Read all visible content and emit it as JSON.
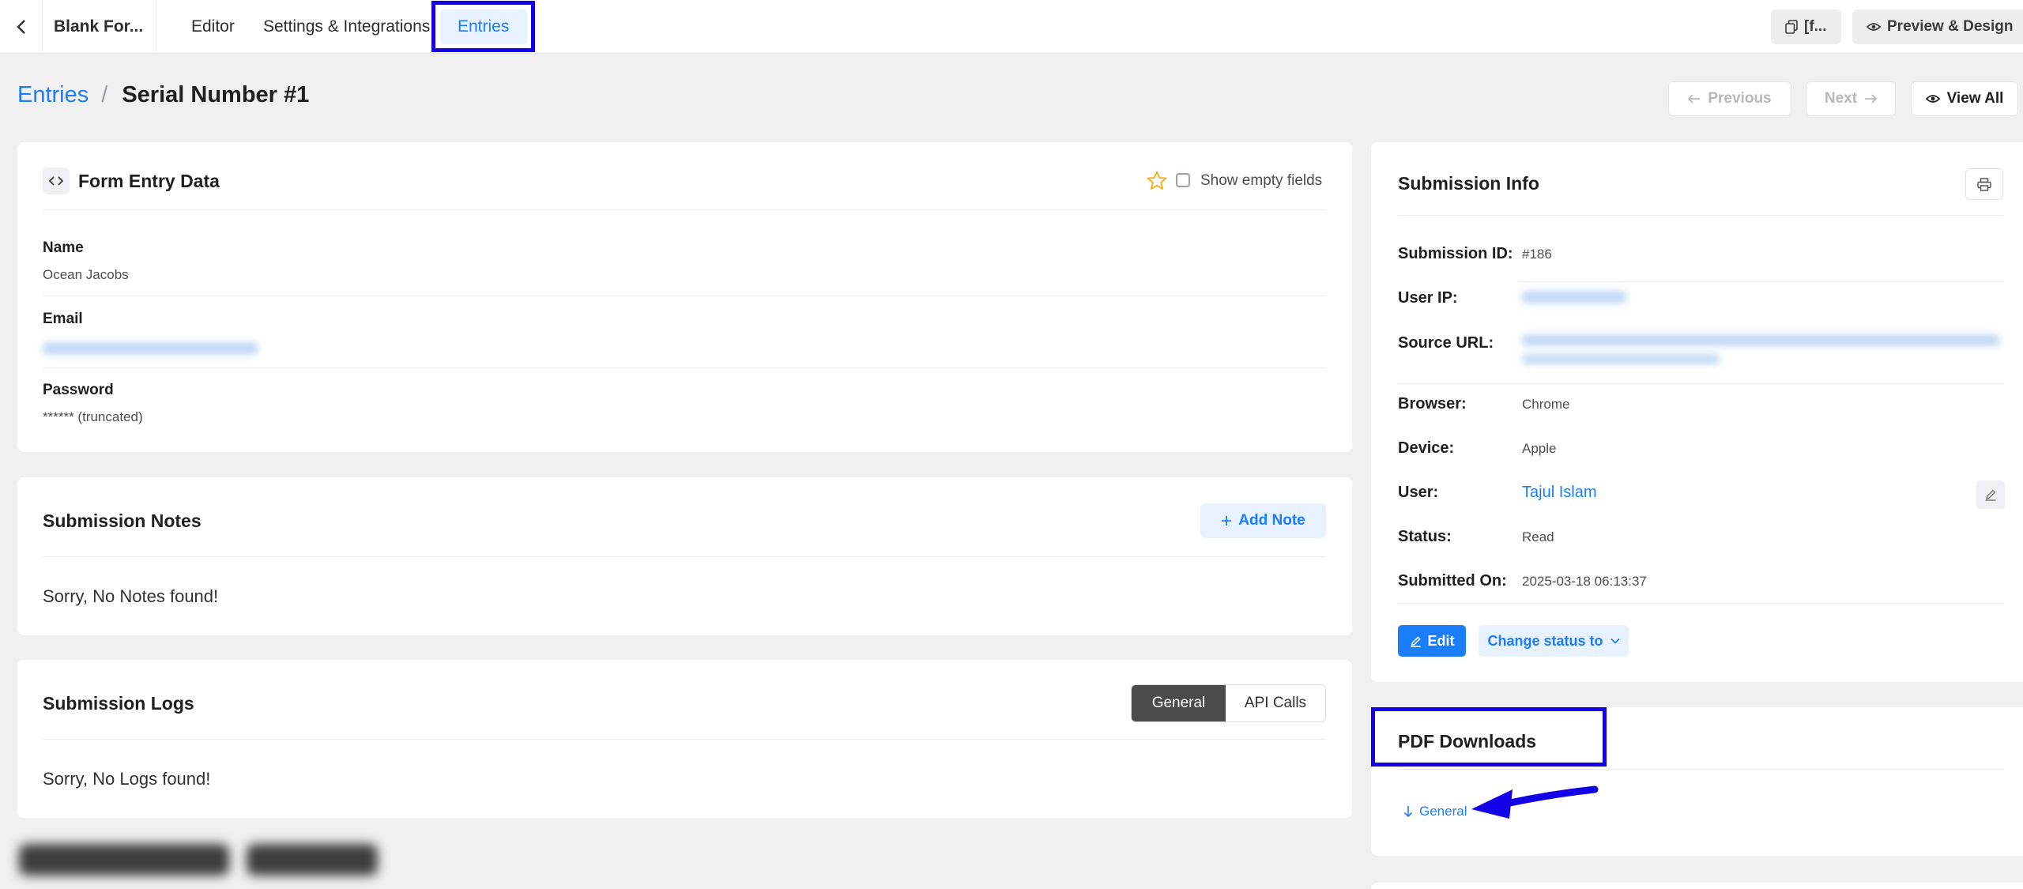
{
  "topbar": {
    "form_name": "Blank For...",
    "tabs": [
      {
        "label": "Editor"
      },
      {
        "label": "Settings & Integrations"
      },
      {
        "label": "Entries"
      }
    ],
    "shortcode_label": "[f...",
    "preview_label": "Preview & Design"
  },
  "breadcrumb": {
    "parent": "Entries",
    "separator": "/",
    "current": "Serial Number #1"
  },
  "entry_nav": {
    "previous": "Previous",
    "next": "Next",
    "view_all": "View All"
  },
  "form_entry": {
    "title": "Form Entry Data",
    "show_empty_label": "Show empty fields",
    "fields": [
      {
        "label": "Name",
        "value": "Ocean Jacobs"
      },
      {
        "label": "Email",
        "value": ""
      },
      {
        "label": "Password",
        "value": "****** (truncated)"
      }
    ]
  },
  "notes": {
    "title": "Submission Notes",
    "add_label": "Add Note",
    "empty": "Sorry, No Notes found!"
  },
  "logs": {
    "title": "Submission Logs",
    "tabs": [
      "General",
      "API Calls"
    ],
    "empty": "Sorry, No Logs found!"
  },
  "submission_info": {
    "title": "Submission Info",
    "rows": [
      {
        "label": "Submission ID:",
        "value": "#186"
      },
      {
        "label": "User IP:",
        "value": ""
      },
      {
        "label": "Source URL:",
        "value": ""
      },
      {
        "label": "Browser:",
        "value": "Chrome"
      },
      {
        "label": "Device:",
        "value": "Apple"
      },
      {
        "label": "User:",
        "value": "Tajul Islam"
      },
      {
        "label": "Status:",
        "value": "Read"
      },
      {
        "label": "Submitted On:",
        "value": "2025-03-18 06:13:37"
      }
    ],
    "edit_label": "Edit",
    "change_status_label": "Change status to"
  },
  "pdf": {
    "title": "PDF Downloads",
    "link_label": "General"
  },
  "colors": {
    "accent": "#1a7efb",
    "annotation": "#1400e6",
    "background": "#f0f0f1"
  }
}
